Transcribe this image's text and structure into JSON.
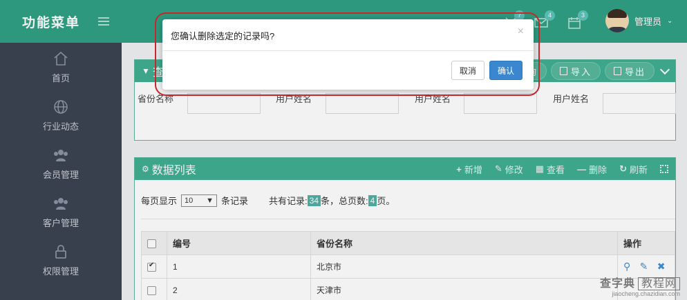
{
  "sidebar": {
    "title": "功能菜单",
    "items": [
      {
        "label": "首页",
        "icon": "home-icon"
      },
      {
        "label": "行业动态",
        "icon": "globe-icon"
      },
      {
        "label": "会员管理",
        "icon": "users-icon"
      },
      {
        "label": "客户管理",
        "icon": "users-icon"
      },
      {
        "label": "权限管理",
        "icon": "lock-icon"
      }
    ]
  },
  "header": {
    "badges": {
      "tasks": "7",
      "mail": "4",
      "calendar": "3"
    },
    "user_name": "管理员"
  },
  "query_panel": {
    "title": "查",
    "buttons": {
      "query": "查询",
      "import": "导入",
      "export": "导出"
    },
    "filters": [
      {
        "label": "省份名称",
        "value": ""
      },
      {
        "label": "用户姓名",
        "value": ""
      },
      {
        "label": "用户姓名",
        "value": ""
      },
      {
        "label": "用户姓名",
        "value": ""
      }
    ]
  },
  "data_panel": {
    "title": "数据列表",
    "actions": {
      "add": "新增",
      "edit": "修改",
      "view": "查看",
      "delete": "删除",
      "refresh": "刷新"
    },
    "page_size_prefix": "每页显示",
    "page_size": "10",
    "page_size_suffix": "条记录",
    "total_prefix": "共有记录:",
    "total_records": "34",
    "total_mid": "条，总页数:",
    "total_pages": "4",
    "total_suffix": "页。",
    "columns": [
      "编号",
      "省份名称",
      "操作"
    ],
    "rows": [
      {
        "id": "1",
        "name": "北京市",
        "checked": true
      },
      {
        "id": "2",
        "name": "天津市",
        "checked": false
      }
    ]
  },
  "modal": {
    "message": "您确认删除选定的记录吗?",
    "close": "×",
    "cancel": "取消",
    "confirm": "确认"
  },
  "watermark": {
    "main": "查字典",
    "box": "教程网",
    "url": "jiaocheng.chazidian.com"
  },
  "colors": {
    "brand": "#2ea083",
    "sidebar": "#3a4250",
    "primary": "#3b87cf",
    "highlight": "#c6262d"
  }
}
